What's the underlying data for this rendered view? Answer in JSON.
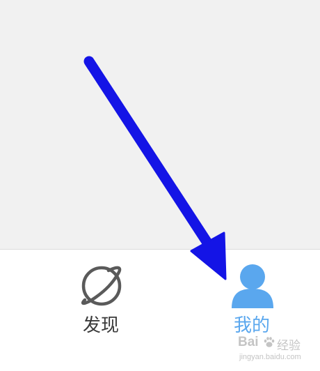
{
  "tab_bar": {
    "tabs": [
      {
        "label": "发现",
        "icon": "planet-icon",
        "active": false
      },
      {
        "label": "我的",
        "icon": "person-icon",
        "active": true
      }
    ]
  },
  "colors": {
    "content_background": "#f1f1f1",
    "tab_bar_background": "#ffffff",
    "inactive_icon": "#5a5a5a",
    "active_blue": "#5aa7ee",
    "annotation_arrow": "#1414e6"
  },
  "annotation": {
    "type": "arrow",
    "points_to": "tab-mine"
  },
  "watermark": {
    "brand_left": "Bai",
    "brand_right": "经验",
    "sub": "jingyan.baidu.com"
  }
}
